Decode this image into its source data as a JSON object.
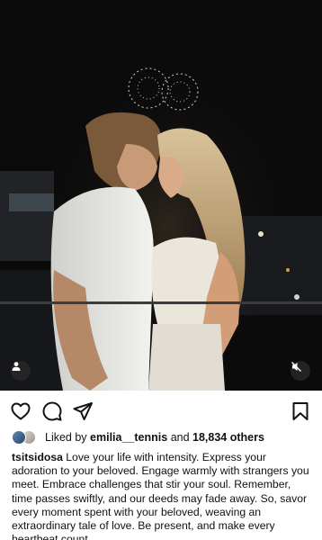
{
  "post": {
    "media": {
      "icons": {
        "user_tag": "person-icon",
        "mute": "speaker-muted-icon"
      }
    },
    "actions": {
      "like_icon": "heart-icon",
      "comment_icon": "comment-bubble-icon",
      "share_icon": "paper-plane-icon",
      "save_icon": "bookmark-icon"
    },
    "likes": {
      "prefix": "Liked by",
      "liker": "emilia__tennis",
      "connector": "and",
      "others": "18,834 others"
    },
    "caption": {
      "username": "tsitsidosa",
      "text": "Love your life with intensity. Express your adoration to your beloved. Engage warmly with strangers you meet. Embrace challenges that stir your soul. Remember, time passes swiftly, and our deeds may fade away. So, savor every moment spent with your beloved, weaving an extraordinary tale of love. Be present, and make every heartbeat count."
    }
  },
  "colors": {
    "text": "#111111",
    "overlay_button_bg": "#282828",
    "background": "#ffffff"
  }
}
